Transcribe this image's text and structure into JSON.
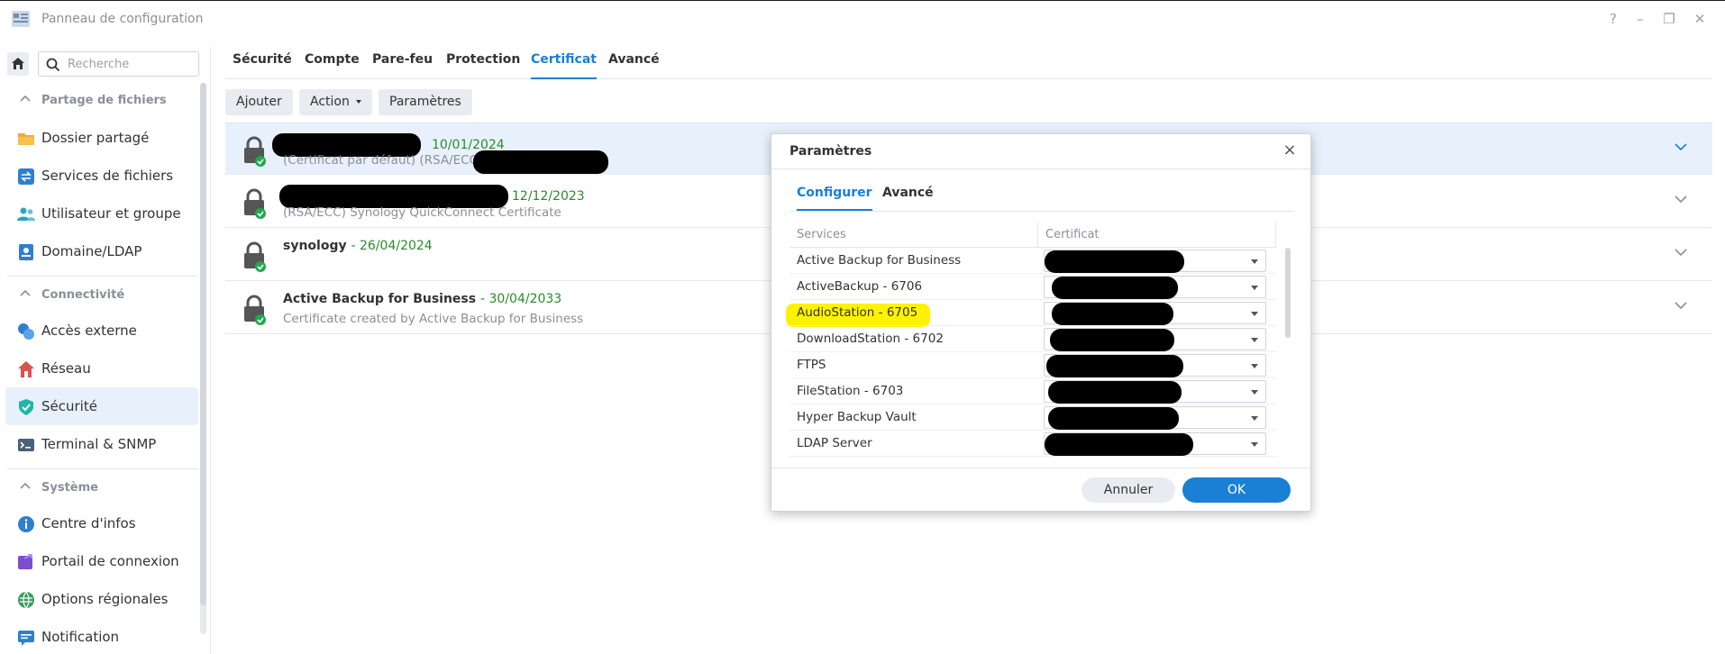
{
  "window": {
    "title": "Panneau de configuration",
    "controls": [
      "?",
      "–",
      "❐",
      "✕"
    ]
  },
  "sidebar": {
    "search_placeholder": "Recherche",
    "sections": [
      {
        "title": "Partage de fichiers",
        "items": [
          "Dossier partagé",
          "Services de fichiers",
          "Utilisateur et groupe",
          "Domaine/LDAP"
        ]
      },
      {
        "title": "Connectivité",
        "items": [
          "Accès externe",
          "Réseau",
          "Sécurité",
          "Terminal & SNMP"
        ]
      },
      {
        "title": "Système",
        "items": [
          "Centre d'infos",
          "Portail de connexion",
          "Options régionales",
          "Notification"
        ]
      }
    ],
    "active_item": "Sécurité"
  },
  "tabs": [
    "Sécurité",
    "Compte",
    "Pare-feu",
    "Protection",
    "Certificat",
    "Avancé"
  ],
  "active_tab": "Certificat",
  "toolbar": {
    "add": "Ajouter",
    "action": "Action",
    "settings": "Paramètres"
  },
  "certificates": [
    {
      "name": "",
      "date": "10/01/2024",
      "desc": "(Certificat par défaut) (RSA/ECC"
    },
    {
      "name": "",
      "date": "12/12/2023",
      "desc": "(RSA/ECC) Synology QuickConnect Certificate"
    },
    {
      "name": "synology",
      "date": "26/04/2024",
      "desc": ""
    },
    {
      "name": "Active Backup for Business",
      "date": "30/04/2033",
      "desc": "Certificate created by Active Backup for Business"
    }
  ],
  "modal": {
    "title": "Paramètres",
    "tabs": [
      "Configurer",
      "Avancé"
    ],
    "active_tab": "Configurer",
    "columns": [
      "Services",
      "Certificat"
    ],
    "services": [
      "Active Backup for Business",
      "ActiveBackup - 6706",
      "AudioStation - 6705",
      "DownloadStation - 6702",
      "FTPS",
      "FileStation - 6703",
      "Hyper Backup Vault",
      "LDAP Server"
    ],
    "highlighted_service": "AudioStation - 6705",
    "cancel": "Annuler",
    "ok": "OK"
  },
  "colors": {
    "accent": "#1a7fd5",
    "date_green": "#2a8a2a",
    "highlight": "#fff200"
  }
}
